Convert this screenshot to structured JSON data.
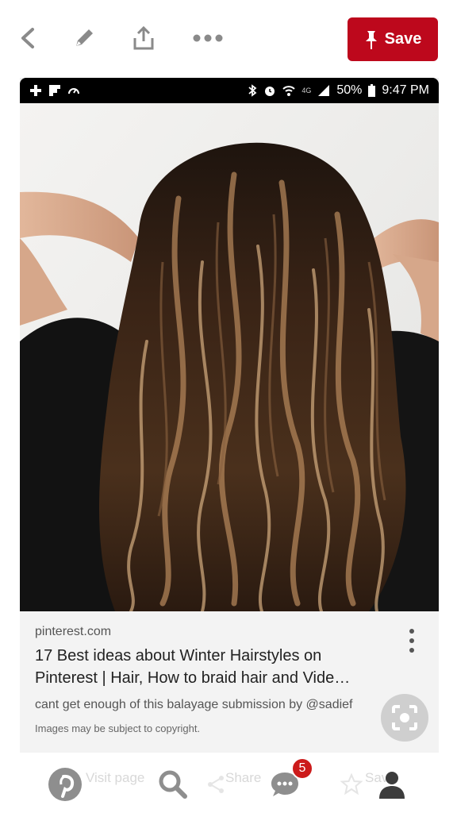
{
  "toolbar": {
    "icons": [
      "back-chevron-icon",
      "pencil-icon",
      "share-icon",
      "more-dots-icon"
    ],
    "save_label": "Save",
    "save_color": "#bd081c"
  },
  "statusbar": {
    "network": "4G",
    "battery": "50%",
    "time": "9:47 PM"
  },
  "pin": {
    "source": "pinterest.com",
    "title_line1": "17 Best ideas about Winter Hairstyles on",
    "title_line2": "Pinterest | Hair, How to braid  hair and Vide…",
    "description": "cant get enough of this balayage submission by @sadief",
    "copyright": "Images may be subject to copyright."
  },
  "bottomnav": {
    "faded_labels": [
      "Visit page",
      "Share",
      "Save"
    ],
    "notification_count": "5",
    "badge_color": "#cc1b1b"
  }
}
